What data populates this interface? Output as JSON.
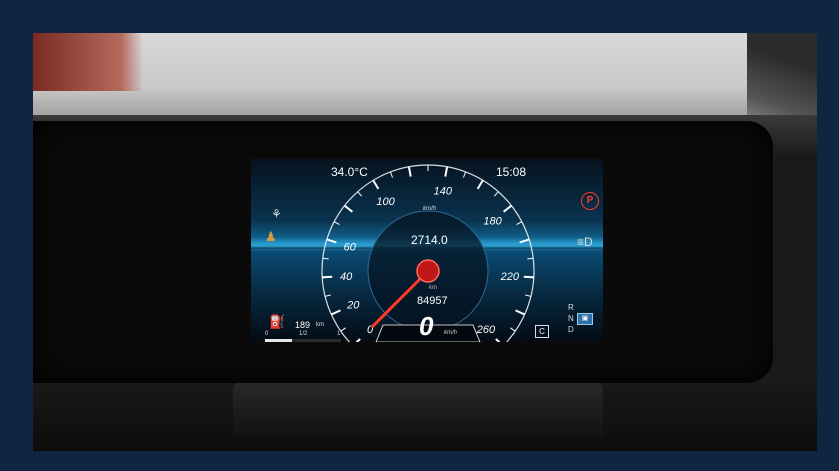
{
  "status": {
    "temperature": "34.0°C",
    "clock": "15:08"
  },
  "speedometer": {
    "top_unit": "km/h",
    "tick_labels": [
      "0",
      "20",
      "40",
      "60",
      "100",
      "140",
      "180",
      "220",
      "260"
    ],
    "trip": "2714.0",
    "odometer_unit": "km",
    "odometer": "84957",
    "speed": "0",
    "speed_unit": "km/h",
    "needle_value_kmh": 0
  },
  "fuel": {
    "range": "189",
    "range_unit": "km",
    "scale": [
      "0",
      "1/2",
      "1"
    ],
    "level_fraction": 0.35
  },
  "gear": {
    "positions": [
      "R",
      "N",
      "D"
    ],
    "mode_indicator": "C"
  },
  "icons": {
    "parking_brake": "P",
    "headlamp": "headlamp-icon",
    "wiper": "wiper-icon",
    "seatbelt": "seatbelt-icon",
    "fuel": "fuel-pump-icon"
  },
  "colors": {
    "frame": "#0f2643",
    "accent_red": "#ff3a2a",
    "gauge_blue": "#2a9fd0"
  }
}
